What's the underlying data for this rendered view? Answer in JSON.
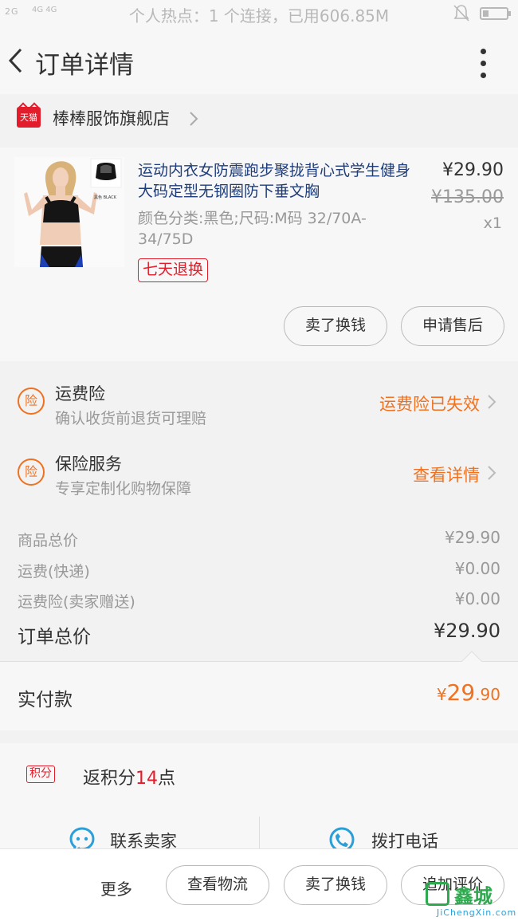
{
  "status_bar": {
    "signal_text": "2G",
    "network_text": "4G 4G",
    "center_text": "个人热点：1 个连接，已用606.85M",
    "battery_level": 0.25
  },
  "header": {
    "title": "订单详情",
    "back_icon": "chevron-left-icon",
    "more_icon": "more-vertical-icon"
  },
  "shop": {
    "badge": "天猫",
    "name": "棒棒服饰旗舰店"
  },
  "product": {
    "title": "运动内衣女防震跑步聚拢背心式学生健身大码定型无钢圈防下垂文胸",
    "price": "¥29.90",
    "original_price": "¥135.00",
    "quantity": "x1",
    "sku": "颜色分类:黑色;尺码:M码 32/70A-34/75D",
    "thumb_caption": "黑色 BLACK",
    "return_tag": "七天退换",
    "buttons": {
      "resell": "卖了换钱",
      "after_sales": "申请售后"
    }
  },
  "insurance": [
    {
      "icon_text": "险",
      "title": "运费险",
      "subtitle": "确认收货前退货可理赔",
      "action": "运费险已失效"
    },
    {
      "icon_text": "险",
      "title": "保险服务",
      "subtitle": "专享定制化购物保障",
      "action": "查看详情"
    }
  ],
  "summary": {
    "items_label": "商品总价",
    "items_value": "¥29.90",
    "shipping_label": "运费(快递)",
    "shipping_value": "¥0.00",
    "ship_ins_label": "运费险(卖家赠送)",
    "ship_ins_value": "¥0.00",
    "total_label": "订单总价",
    "total_value": "¥29.90"
  },
  "paid": {
    "label": "实付款",
    "currency": "¥",
    "integer": "29",
    "decimal": ".90"
  },
  "points": {
    "badge": "积分",
    "text_prefix": "返积分",
    "value": "14",
    "text_suffix": "点"
  },
  "contact": {
    "seller": "联系卖家",
    "phone": "拨打电话"
  },
  "bottom_bar": {
    "more": "更多",
    "logistics": "查看物流",
    "resell": "卖了换钱",
    "review": "追加评价"
  },
  "watermark": {
    "text": "鑫城",
    "url": "JiChengXin.com"
  },
  "colors": {
    "accent": "#f0711f",
    "tmall_red": "#e21c2a",
    "title_blue": "#1f3d7a"
  }
}
